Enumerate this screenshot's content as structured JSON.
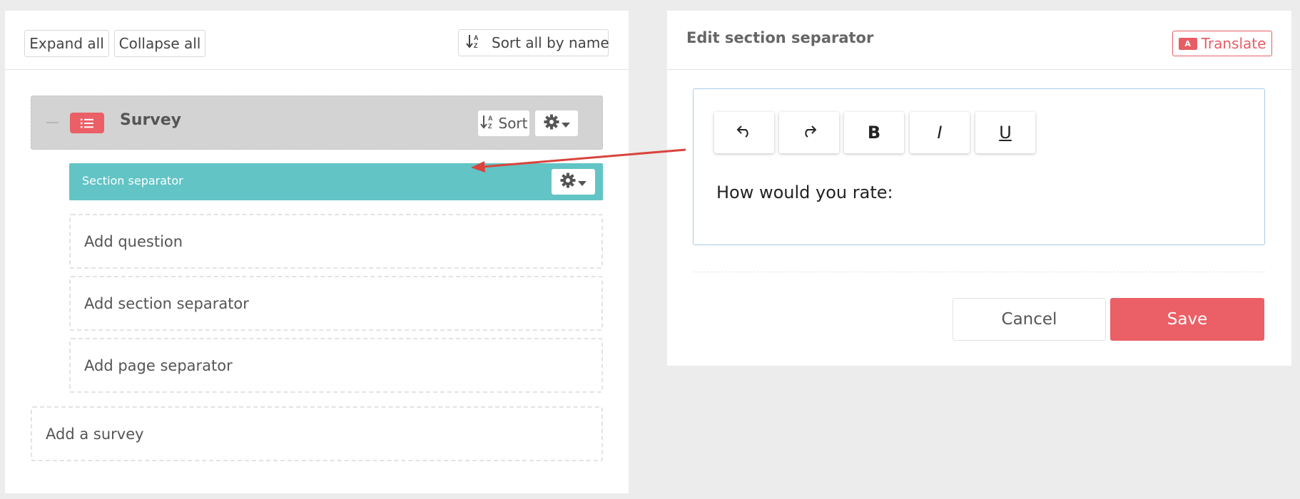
{
  "left": {
    "toolbar": {
      "expand_all": "Expand all",
      "collapse_all": "Collapse all",
      "sort_all": "Sort all by name",
      "sort_icon": "sort-alpha-icon"
    },
    "survey": {
      "title": "Survey",
      "icon": "list-icon",
      "sort_label": "Sort",
      "gear_icon": "gear-icon"
    },
    "section_separator": {
      "title": "Section separator"
    },
    "add_question": "Add question",
    "add_section_separator": "Add section separator",
    "add_page_separator": "Add page separator",
    "add_survey": "Add a survey"
  },
  "right": {
    "title": "Edit section separator",
    "translate": "Translate",
    "toolbar": {
      "undo": "↶",
      "redo": "↷",
      "bold": "B",
      "italic": "I",
      "underline": "U"
    },
    "editor_text": "How would you rate:",
    "cancel": "Cancel",
    "save": "Save"
  },
  "colors": {
    "accent_red": "#eb5f66",
    "teal": "#62c4c5",
    "survey_bg": "#d3d3d3",
    "editor_border": "#a9cbe7"
  }
}
